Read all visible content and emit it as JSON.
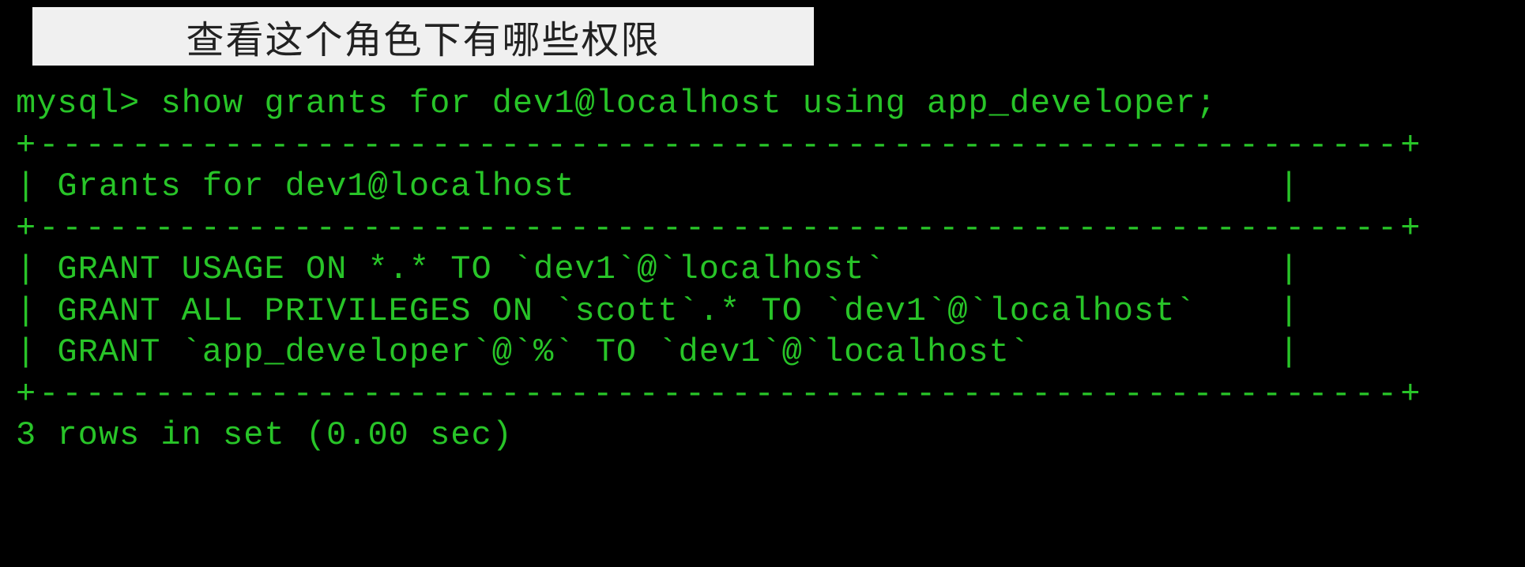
{
  "caption": "查看这个角色下有哪些权限",
  "terminal": {
    "prompt": "mysql> ",
    "command": "show grants for dev1@localhost using app_developer;",
    "border_top": "+-----------------------------------------------------------+",
    "header_pipe_left": "| ",
    "header_text": "Grants for dev1@localhost",
    "header_pipe_right": "                                  |",
    "border_mid": "+-----------------------------------------------------------+",
    "rows": [
      {
        "pipe_left": "| ",
        "text": "GRANT USAGE ON *.* TO `dev1`@`localhost`",
        "pipe_right": "                   |"
      },
      {
        "pipe_left": "| ",
        "text": "GRANT ALL PRIVILEGES ON `scott`.* TO `dev1`@`localhost`",
        "pipe_right": "    |"
      },
      {
        "pipe_left": "| ",
        "text": "GRANT `app_developer`@`%` TO `dev1`@`localhost`",
        "pipe_right": "            |"
      }
    ],
    "border_bot": "+-----------------------------------------------------------+",
    "summary": "3 rows in set (0.00 sec)"
  }
}
